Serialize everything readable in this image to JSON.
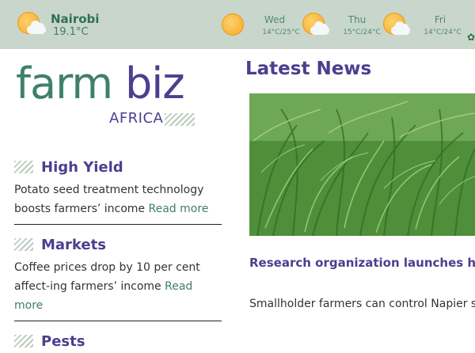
{
  "weather": {
    "city": "Nairobi",
    "current_temp": "19.1°C",
    "forecast": [
      {
        "day": "Wed",
        "range": "14°C/25°C",
        "icon": "sun-cloud-icon"
      },
      {
        "day": "Thu",
        "range": "15°C/24°C",
        "icon": "sun-cloud-icon"
      },
      {
        "day": "Fri",
        "range": "14°C/24°C",
        "icon": "sun-cloud-icon"
      }
    ],
    "current_icon": "sun-cloud-icon",
    "extra_icon": "sun-icon"
  },
  "logo": {
    "farm": "farm",
    "biz": "biz",
    "africa": "AFRICA"
  },
  "sidebar": {
    "sections": [
      {
        "title": "High Yield",
        "body": "Potato seed treatment technology boosts farmers’ income",
        "link": "Read more"
      },
      {
        "title": "Markets",
        "body": "Coffee prices drop by 10 per cent affect-ing farmers’ income",
        "link": "Read more"
      },
      {
        "title": "Pests"
      }
    ]
  },
  "news": {
    "heading": "Latest News",
    "headline": "Research organization launches high yielding resistant Napier ...",
    "excerpt": "Smallholder farmers can control Napier stunt"
  },
  "colors": {
    "bar_bg": "#c9d6cc",
    "brand_green": "#3f8068",
    "brand_purple": "#4a3f8f"
  }
}
